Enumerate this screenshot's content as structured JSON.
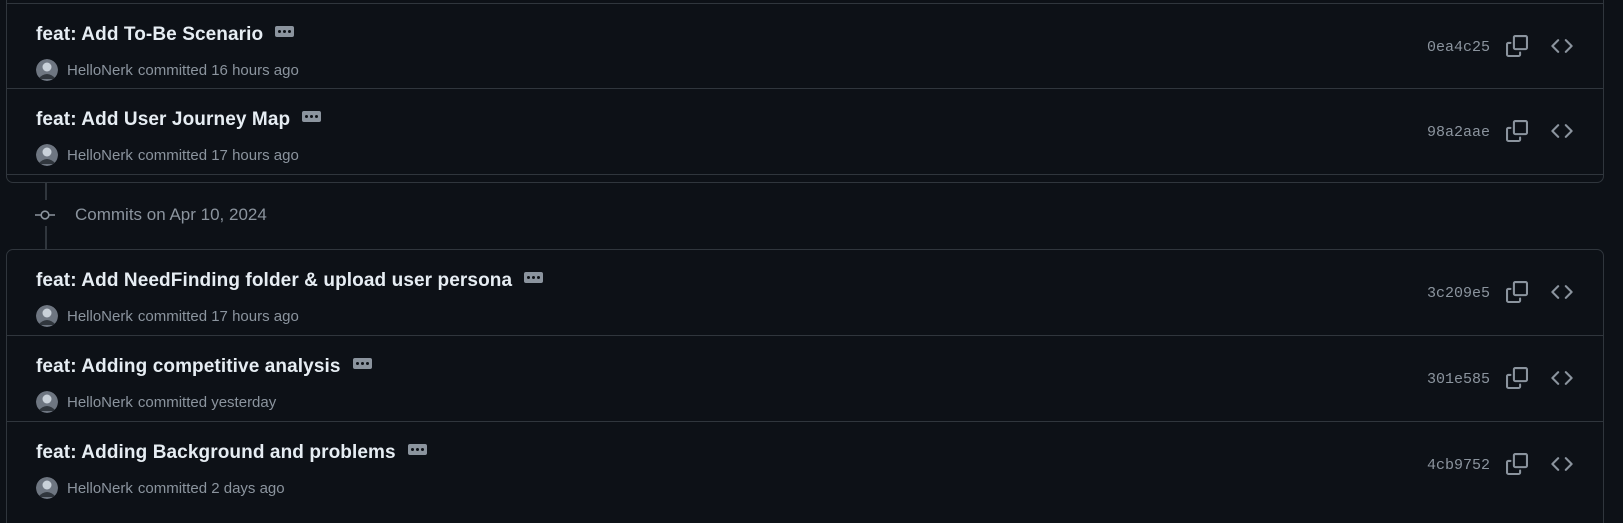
{
  "colors": {
    "background": "#0d1117",
    "border": "#30363d",
    "text_primary": "#e6edf3",
    "text_muted": "#8b949e"
  },
  "groups": [
    {
      "commits": [
        {
          "title": "feat: Add To-Be Scenario",
          "author": "HelloNerk",
          "time_text": "committed 16 hours ago",
          "sha": "0ea4c25"
        },
        {
          "title": "feat: Add User Journey Map",
          "author": "HelloNerk",
          "time_text": "committed 17 hours ago",
          "sha": "98a2aae"
        }
      ]
    },
    {
      "heading": "Commits on Apr 10, 2024",
      "commits": [
        {
          "title": "feat: Add NeedFinding folder & upload user persona",
          "author": "HelloNerk",
          "time_text": "committed 17 hours ago",
          "sha": "3c209e5"
        },
        {
          "title": "feat: Adding competitive analysis",
          "author": "HelloNerk",
          "time_text": "committed yesterday",
          "sha": "301e585"
        },
        {
          "title": "feat: Adding Background and problems",
          "author": "HelloNerk",
          "time_text": "committed 2 days ago",
          "sha": "4cb9752"
        }
      ]
    }
  ],
  "icons": {
    "ellipsis": "kebab-horizontal-icon",
    "copy": "copy-icon",
    "browse": "code-icon",
    "timeline": "git-commit-icon",
    "avatar": "avatar"
  }
}
